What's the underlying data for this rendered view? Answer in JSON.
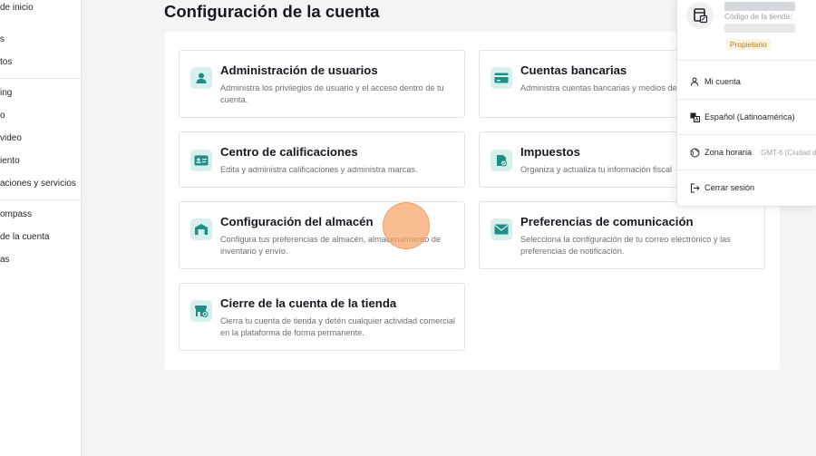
{
  "sidebar": {
    "items": [
      {
        "label": "de inicio"
      },
      {
        "label": "s"
      },
      {
        "label": "tos"
      },
      {
        "label": "ing"
      },
      {
        "label": "o"
      },
      {
        "label": "video"
      },
      {
        "label": "iento"
      },
      {
        "label": "aciones y servicios"
      },
      {
        "label": "ompass"
      },
      {
        "label": "de la cuenta"
      },
      {
        "label": "as"
      }
    ]
  },
  "main": {
    "title": "Configuración de la cuenta",
    "cards": [
      {
        "title": "Administración de usuarios",
        "desc": "Administra los privilegios de usuario y el acceso dentro de tu cuenta.",
        "icon": "user-icon"
      },
      {
        "title": "Cuentas bancarias",
        "desc": "Administra cuentas bancarias y medios de",
        "icon": "bank-card-icon"
      },
      {
        "title": "Centro de calificaciones",
        "desc": "Edita y administra calificaciones y administra marcas.",
        "icon": "id-card-icon"
      },
      {
        "title": "Impuestos",
        "desc": "Organiza y actualiza tu información fiscal",
        "icon": "tax-document-icon"
      },
      {
        "title": "Configuración del almacén",
        "desc": "Configura tus preferencias de almacén, almacenamiento de inventario y envío.",
        "icon": "warehouse-icon"
      },
      {
        "title": "Preferencias de comunicación",
        "desc": "Selecciona la configuración de tu correo electrónico y las preferencias de notificación.",
        "icon": "mail-icon"
      },
      {
        "title": "Cierre de la cuenta de la tienda",
        "desc": "Cierra tu cuenta de tienda y detén cualquier actividad comercial en la plataforma de forma permanente.",
        "icon": "store-close-icon"
      }
    ]
  },
  "account_menu": {
    "store_code_label": "Código de la tienda:",
    "role_badge": "Propietario",
    "items": [
      {
        "label": "Mi cuenta",
        "icon": "person-icon"
      },
      {
        "label": "Español (Latinoamérica)",
        "icon": "translate-icon"
      },
      {
        "label": "Zona horaria",
        "sub": "GMT-6 (Ciudad d",
        "icon": "globe-icon"
      },
      {
        "label": "Cerrar sesión",
        "icon": "logout-icon"
      }
    ]
  },
  "colors": {
    "accent": "#1e8e86",
    "icon_bg": "#d7efed",
    "badge_text": "#c07a17",
    "badge_bg": "#fdf3e1"
  }
}
